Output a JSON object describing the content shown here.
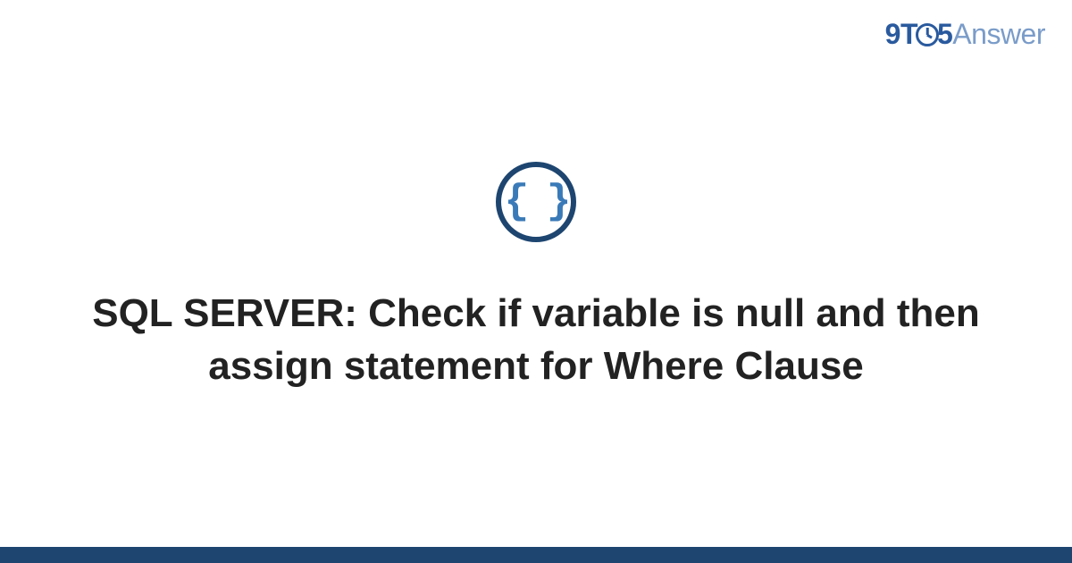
{
  "logo": {
    "part1": "9T",
    "part2": "5",
    "part3": "Answer"
  },
  "icon": {
    "braces": "{ }",
    "name": "code-braces-icon"
  },
  "title": "SQL SERVER: Check if variable is null and then assign statement for Where Clause",
  "colors": {
    "primary": "#1d4570",
    "accent": "#3a7ab8",
    "logo_dark": "#2a5a9e",
    "logo_light": "#7a9cc9",
    "text": "#222222"
  }
}
